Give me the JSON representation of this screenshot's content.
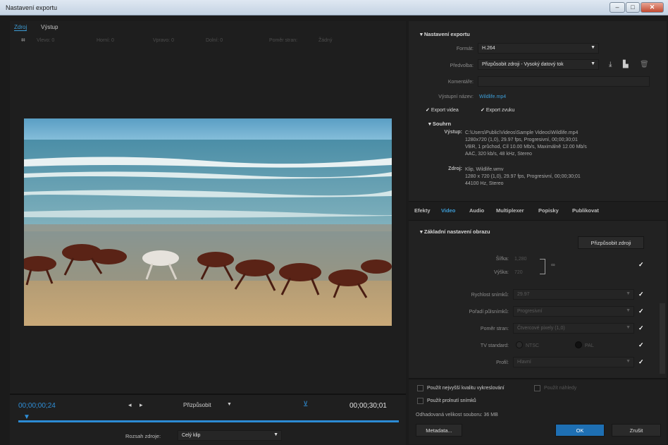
{
  "window": {
    "title": "Nastavení exportu",
    "min": "–",
    "max": "□",
    "close": "✕"
  },
  "left": {
    "tabs": [
      "Zdroj",
      "Výstup"
    ],
    "toolbar": [
      "Vlevo: 0",
      "Horní: 0",
      "Vpravo: 0",
      "Dolní: 0",
      "Poměr stran:",
      "Žádný"
    ],
    "timecode_start": "00;00;00;24",
    "timecode_end": "00;00;30;01",
    "fit_label": "Přizpůsobit",
    "range_label": "Rozsah zdroje:",
    "range_value": "Celý klip"
  },
  "right": {
    "section_export": "Nastavení exportu",
    "format_label": "Formát:",
    "format_value": "H.264",
    "preset_label": "Předvolba:",
    "preset_value": "Přizpůsobit zdroji - Vysoký datový tok",
    "comments_label": "Komentáře:",
    "output_name_label": "Výstupní název:",
    "output_name_value": "Wildlife.mp4",
    "export_video": "Export videa",
    "export_audio": "Export zvuku",
    "summary_title": "Souhrn",
    "output_label": "Výstup:",
    "output_lines": [
      "C:\\Users\\Public\\Videos\\Sample Videos\\Wildlife.mp4",
      "1280x720 (1,0), 29.97 fps, Progresivní, 00;00;30;01",
      "VBR, 1 průchod, Cíl 10.00 Mb/s, Maximálně 12.00 Mb/s",
      "AAC, 320 kb/s, 48  kHz, Stereo"
    ],
    "source_label": "Zdroj:",
    "source_lines": [
      "Klip, Wildlife.wmv",
      "1280 x 720 (1,0), 29.97 fps, Progresivní, 00;00;30;01",
      "44100 Hz, Stereo"
    ],
    "tabs": [
      "Efekty",
      "Video",
      "Audio",
      "Multiplexer",
      "Popisky",
      "Publikovat"
    ],
    "basic_title": "Základní nastavení obrazu",
    "match_source": "Přizpůsobit zdroji",
    "width_label": "Šířka:",
    "width_value": "1,280",
    "height_label": "Výška:",
    "height_value": "720",
    "framerate_label": "Rychlost snímků:",
    "framerate_value": "29.97",
    "field_label": "Pořadí půlsnímků:",
    "field_value": "Progresivní",
    "aspect_label": "Poměr stran:",
    "aspect_value": "Čtvercové pixely (1,0)",
    "tv_label": "TV standard:",
    "tv_ntsc": "NTSC",
    "tv_pal": "PAL",
    "profile_label": "Profil:",
    "profile_value": "Hlavní",
    "max_quality": "Použít nejvyšší kvalitu vykreslování",
    "previews": "Použít náhledy",
    "frame_blend": "Použít prolnutí snímků",
    "est_size": "Odhadovaná velikost souboru: 36 MB",
    "metadata": "Metadata...",
    "ok": "OK",
    "cancel": "Zrušit"
  },
  "colors": {
    "accent": "#3d9dd6",
    "ok_button": "#1e6fb3"
  }
}
